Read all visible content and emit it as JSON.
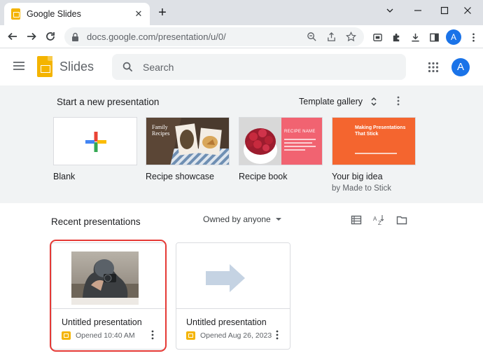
{
  "browser": {
    "tab_title": "Google Slides",
    "url": "docs.google.com/presentation/u/0/",
    "profile_initial": "A"
  },
  "app": {
    "name": "Slides",
    "search_placeholder": "Search",
    "account_initial": "A"
  },
  "start": {
    "heading": "Start a new presentation",
    "gallery_label": "Template gallery",
    "templates": [
      {
        "label": "Blank",
        "sub": ""
      },
      {
        "label": "Recipe showcase",
        "sub": "",
        "thumb_title": "Family Recipes"
      },
      {
        "label": "Recipe book",
        "sub": "",
        "thumb_title": "RECIPE NAME"
      },
      {
        "label": "Your big idea",
        "sub": "by Made to Stick",
        "thumb_title": "Making Presentations That Stick"
      }
    ]
  },
  "recent": {
    "heading": "Recent presentations",
    "owner_filter": "Owned by anyone",
    "docs": [
      {
        "title": "Untitled presentation",
        "date": "Opened 10:40 AM"
      },
      {
        "title": "Untitled presentation",
        "date": "Opened Aug 26, 2023"
      }
    ]
  },
  "colors": {
    "slides_yellow": "#f4b400",
    "accent_blue": "#1a73e8",
    "highlight_red": "#e53935",
    "recipe_book_pink": "#f16371",
    "big_idea_orange": "#f4652f"
  }
}
